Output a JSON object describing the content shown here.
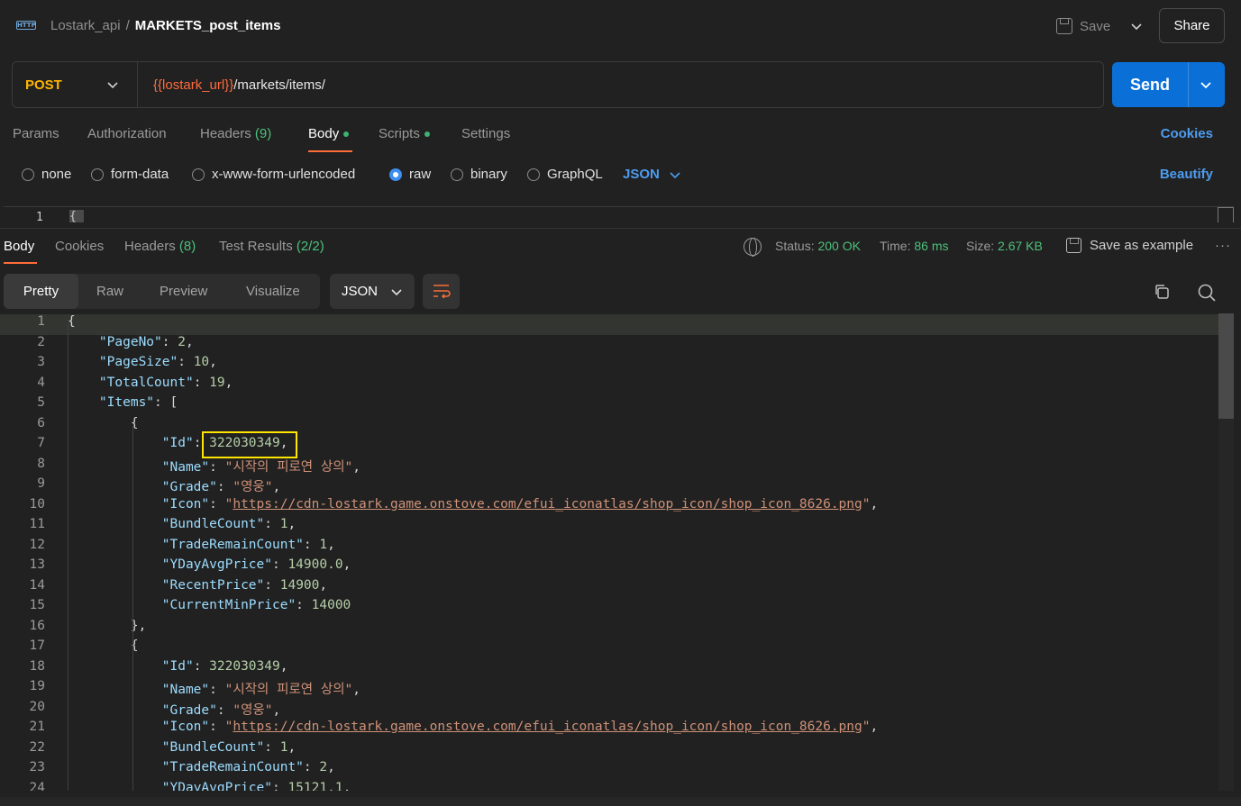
{
  "header": {
    "collection": "Lostark_api",
    "separator": "/",
    "request_name": "MARKETS_post_items",
    "save_label": "Save",
    "share_label": "Share",
    "http_icon_text": "HTTP"
  },
  "request": {
    "method": "POST",
    "url_var": "{{lostark_url}}",
    "url_path": "/markets/items/",
    "send_label": "Send"
  },
  "req_tabs": {
    "params": "Params",
    "authorization": "Authorization",
    "headers": "Headers",
    "headers_count": "(9)",
    "body": "Body",
    "scripts": "Scripts",
    "settings": "Settings",
    "cookies": "Cookies"
  },
  "body_types": {
    "none": "none",
    "form_data": "form-data",
    "urlencoded": "x-www-form-urlencoded",
    "raw": "raw",
    "binary": "binary",
    "graphql": "GraphQL",
    "selected": "raw",
    "format": "JSON",
    "beautify": "Beautify"
  },
  "request_editor": {
    "line_no": "1",
    "first_char": "{"
  },
  "response": {
    "tabs": {
      "body": "Body",
      "cookies": "Cookies",
      "headers": "Headers",
      "headers_count": "(8)",
      "test_results": "Test Results",
      "test_count": "(2/2)"
    },
    "status_label": "Status:",
    "status_value": "200 OK",
    "time_label": "Time:",
    "time_value": "86 ms",
    "size_label": "Size:",
    "size_value": "2.67 KB",
    "save_example": "Save as example",
    "more": "···",
    "view_modes": {
      "pretty": "Pretty",
      "raw": "Raw",
      "preview": "Preview",
      "visualize": "Visualize"
    },
    "format": "JSON"
  },
  "code_lines": [
    "{",
    "    \"PageNo\": 2,",
    "    \"PageSize\": 10,",
    "    \"TotalCount\": 19,",
    "    \"Items\": [",
    "        {",
    "            \"Id\": 322030349,",
    "            \"Name\": \"시작의 피로연 상의\",",
    "            \"Grade\": \"영웅\",",
    "            \"Icon\": \"https://cdn-lostark.game.onstove.com/efui_iconatlas/shop_icon/shop_icon_8626.png\",",
    "            \"BundleCount\": 1,",
    "            \"TradeRemainCount\": 1,",
    "            \"YDayAvgPrice\": 14900.0,",
    "            \"RecentPrice\": 14900,",
    "            \"CurrentMinPrice\": 14000",
    "        },",
    "        {",
    "            \"Id\": 322030349,",
    "            \"Name\": \"시작의 피로연 상의\",",
    "            \"Grade\": \"영웅\",",
    "            \"Icon\": \"https://cdn-lostark.game.onstove.com/efui_iconatlas/shop_icon/shop_icon_8626.png\",",
    "            \"BundleCount\": 1,",
    "            \"TradeRemainCount\": 2,",
    "            \"YDayAvgPrice\": 15121.1,"
  ],
  "colors": {
    "accent": "#ff6c37",
    "send": "#0a70d8",
    "method": "#ffb400",
    "link": "#4d9cf0",
    "success": "#4ec07b",
    "highlight_box": "#ffe600"
  }
}
